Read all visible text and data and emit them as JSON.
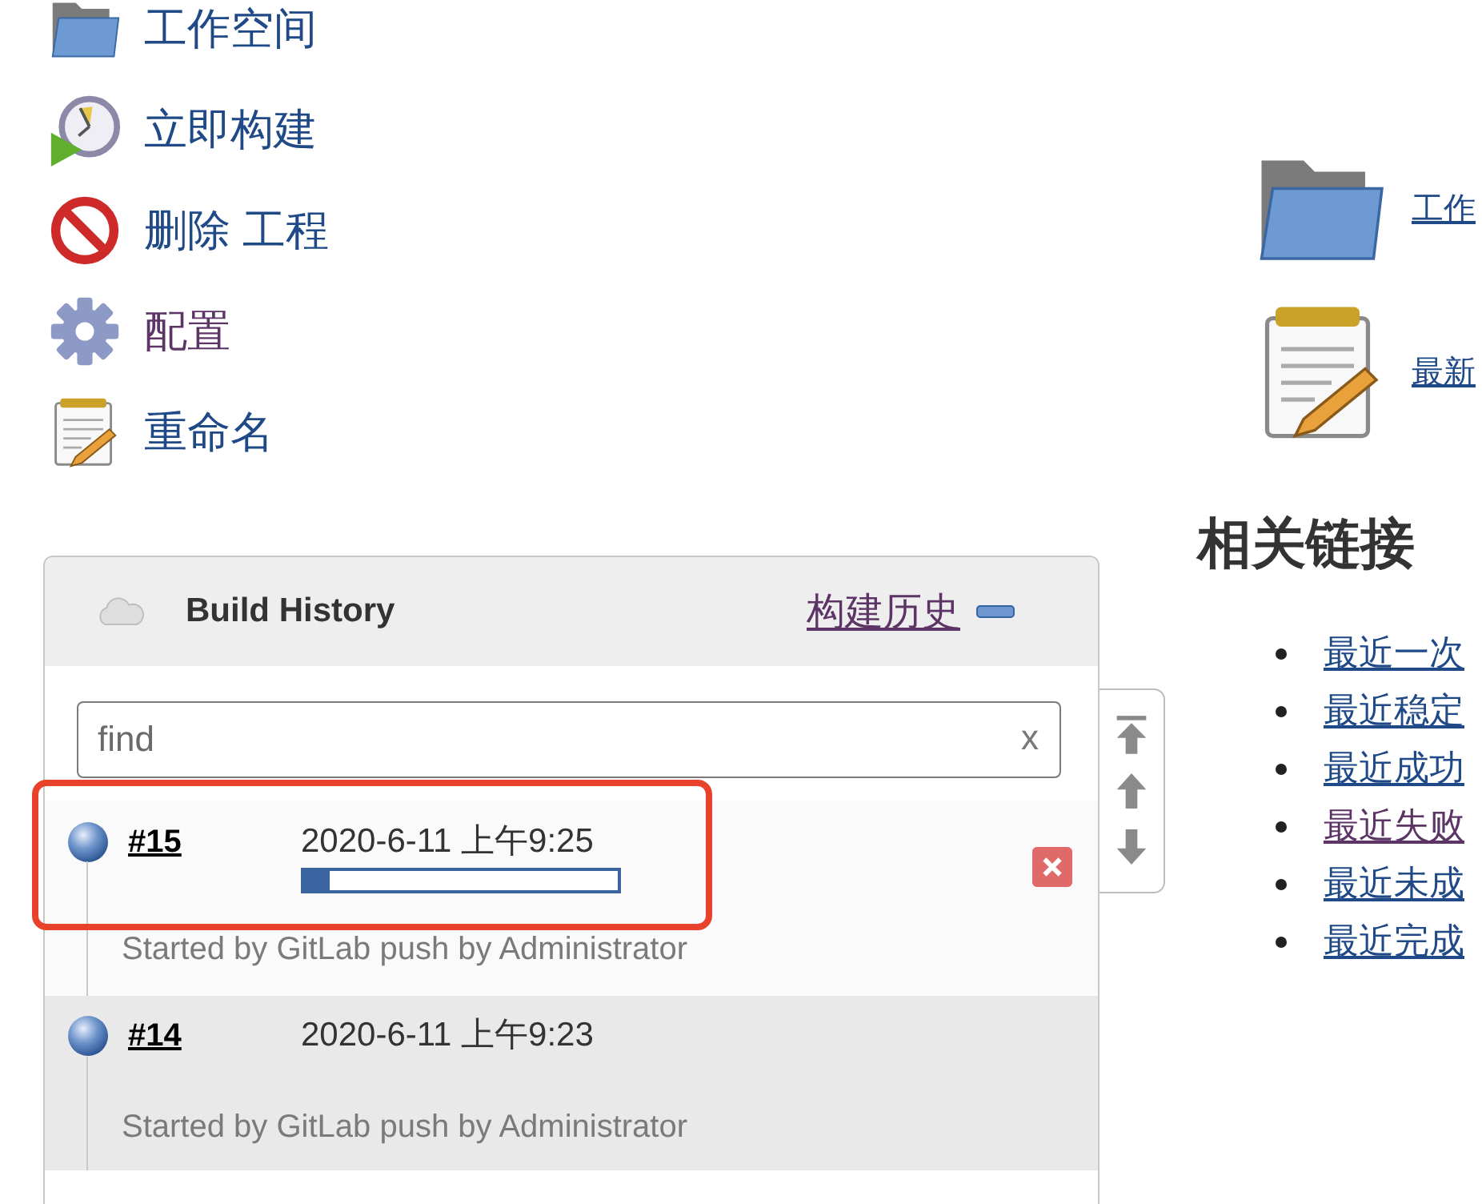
{
  "side_menu": [
    {
      "label": "工作空间",
      "kind": "workspace",
      "visited": false
    },
    {
      "label": "立即构建",
      "kind": "build",
      "visited": false
    },
    {
      "label": "删除 工程",
      "kind": "delete",
      "visited": false
    },
    {
      "label": "配置",
      "kind": "configure",
      "visited": true
    },
    {
      "label": "重命名",
      "kind": "rename",
      "visited": false
    }
  ],
  "top_links": [
    {
      "label": "工作",
      "kind": "workspace"
    },
    {
      "label": "最新",
      "kind": "changes"
    }
  ],
  "build_history": {
    "title": "Build History",
    "link": "构建历史",
    "link_visited": true,
    "search": {
      "placeholder": "find",
      "clear": "x"
    },
    "builds": [
      {
        "number": "#15",
        "time": "2020-6-11 上午9:25",
        "running": true,
        "level": 0.08,
        "highlighted": true,
        "cause": "Started by GitLab push by Administrator"
      },
      {
        "number": "#14",
        "time": "2020-6-11 上午9:23",
        "running": false,
        "highlighted": false,
        "cause": "Started by GitLab push by Administrator"
      }
    ]
  },
  "related_links": {
    "title": "相关链接",
    "items": [
      {
        "label": "最近一次",
        "visited": false
      },
      {
        "label": "最近稳定",
        "visited": false
      },
      {
        "label": "最近成功",
        "visited": false
      },
      {
        "label": "最近失败",
        "visited": true
      },
      {
        "label": "最近未成",
        "visited": false
      },
      {
        "label": "最近完成",
        "visited": false
      }
    ]
  }
}
